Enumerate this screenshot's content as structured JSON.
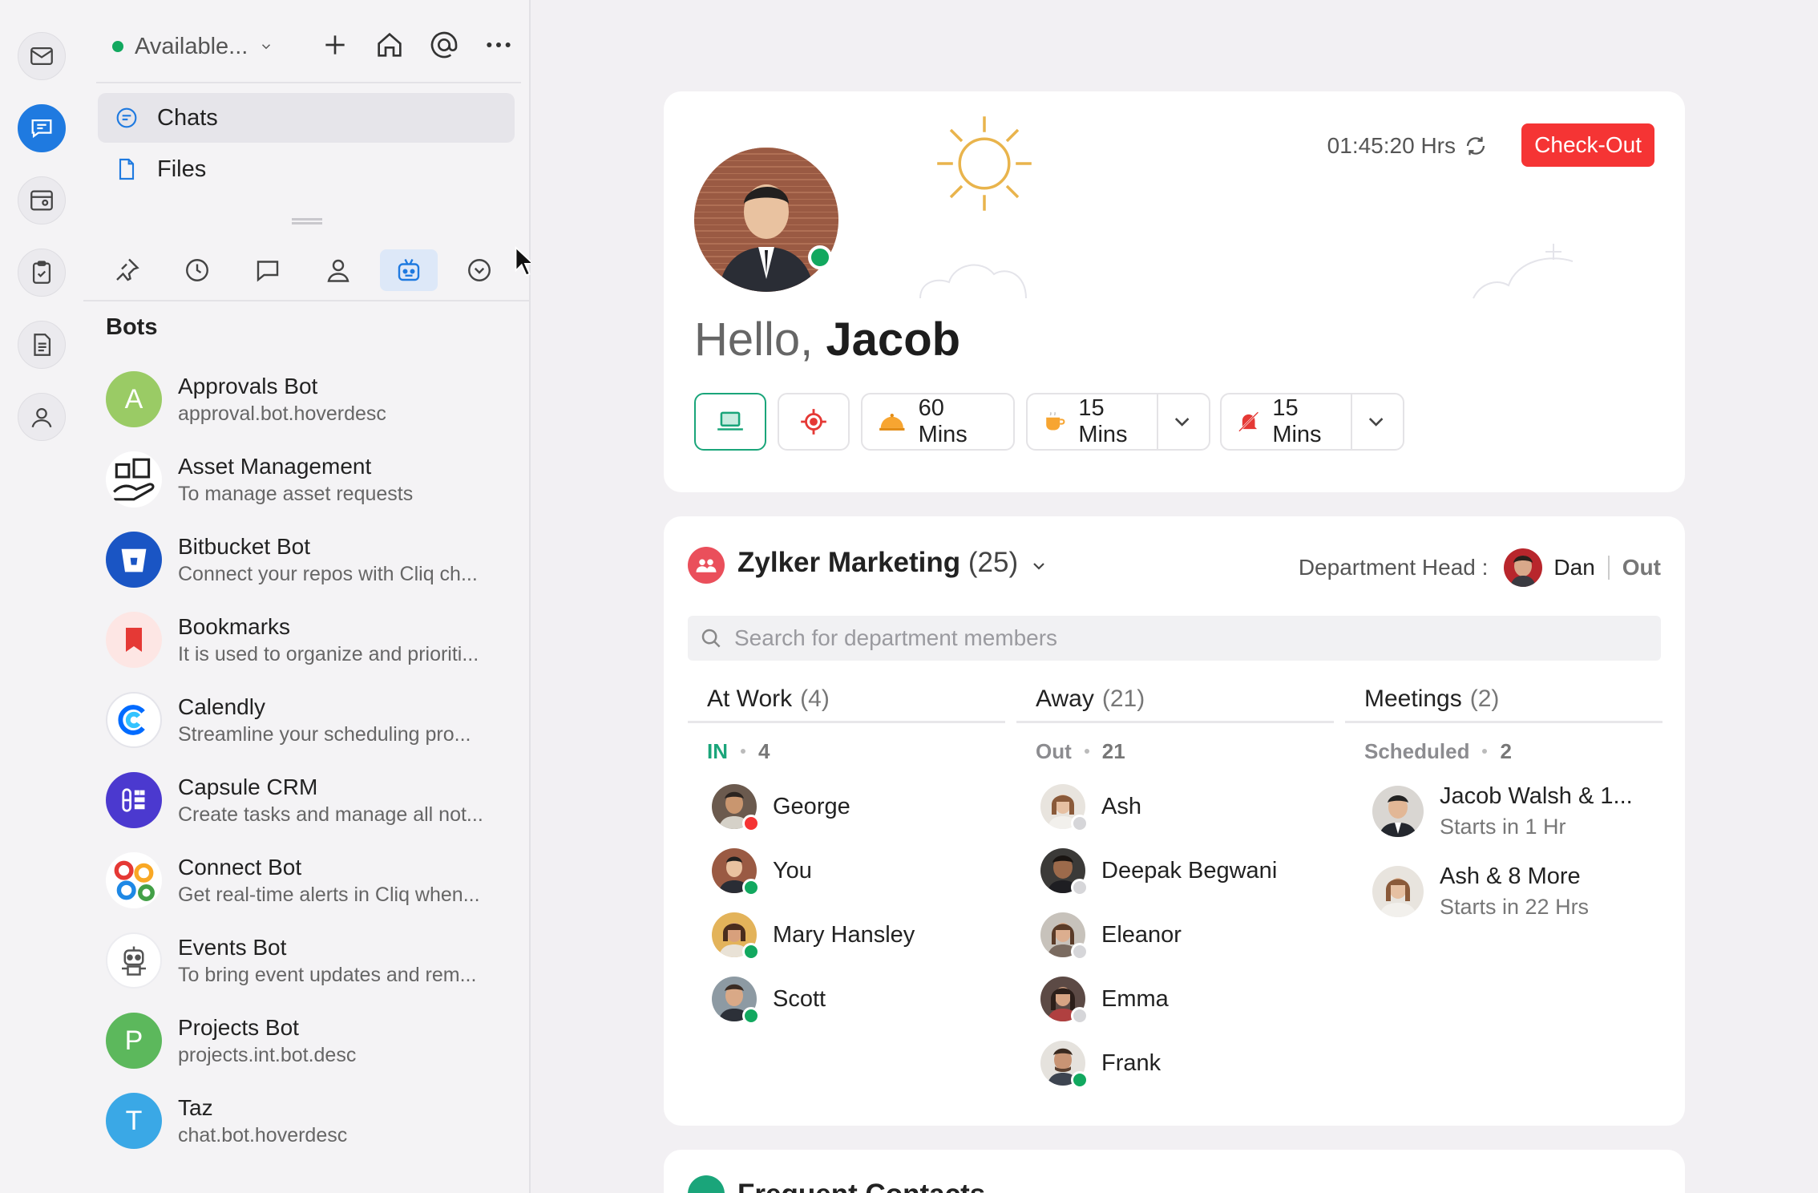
{
  "colors": {
    "accent": "#1f7ae0",
    "online": "#12a85f",
    "busy": "#f53434",
    "checkout": "#f53434",
    "at_work": "#1aa57a",
    "away": "#8c8c90",
    "dept_icon": "#ea4f5b"
  },
  "rail": {
    "items": [
      {
        "name": "mail-icon"
      },
      {
        "name": "chat-icon"
      },
      {
        "name": "inbox-icon"
      },
      {
        "name": "clipboard-icon"
      },
      {
        "name": "notes-icon"
      },
      {
        "name": "contacts-icon"
      }
    ]
  },
  "sidebar": {
    "status": "Available...",
    "nav": [
      {
        "label": "Chats",
        "icon": "chat-bubble-icon"
      },
      {
        "label": "Files",
        "icon": "file-icon"
      }
    ],
    "tabs": [
      "pin-icon",
      "clock-icon",
      "channels-icon",
      "contact-icon",
      "bot-icon",
      "more-icon"
    ],
    "section_title": "Bots",
    "bots": [
      {
        "name": "Approvals Bot",
        "desc": "approval.bot.hoverdesc",
        "initial": "A",
        "color": "#9acb65"
      },
      {
        "name": "Asset Management",
        "desc": "To manage asset requests",
        "initial": "",
        "color": "#ffffff"
      },
      {
        "name": "Bitbucket Bot",
        "desc": "Connect your repos with Cliq ch...",
        "initial": "",
        "color": "#1a55c4"
      },
      {
        "name": "Bookmarks",
        "desc": "It is used to organize and prioriti...",
        "initial": "",
        "color": "#fde6e4"
      },
      {
        "name": "Calendly",
        "desc": "Streamline your scheduling pro...",
        "initial": "",
        "color": "#ffffff"
      },
      {
        "name": "Capsule CRM",
        "desc": "Create tasks and manage all not...",
        "initial": "",
        "color": "#4b39cf"
      },
      {
        "name": "Connect Bot",
        "desc": "Get real-time alerts in Cliq when...",
        "initial": "",
        "color": "#ffffff"
      },
      {
        "name": "Events Bot",
        "desc": "To bring event updates and rem...",
        "initial": "",
        "color": "#ffffff"
      },
      {
        "name": "Projects Bot",
        "desc": "projects.int.bot.desc",
        "initial": "P",
        "color": "#5cb85c"
      },
      {
        "name": "Taz",
        "desc": "chat.bot.hoverdesc",
        "initial": "T",
        "color": "#3aa8e6"
      }
    ]
  },
  "hello": {
    "greeting": "Hello,",
    "name": "Jacob",
    "timer": "01:45:20 Hrs",
    "checkout": "Check-Out",
    "chips": [
      {
        "icon": "laptop-icon",
        "label": ""
      },
      {
        "icon": "target-icon",
        "label": ""
      },
      {
        "icon": "lunch-icon",
        "label": "60 Mins"
      },
      {
        "icon": "coffee-icon",
        "label": "15 Mins"
      },
      {
        "icon": "do-not-disturb-icon",
        "label": "15 Mins"
      }
    ]
  },
  "department": {
    "name": "Zylker Marketing",
    "count": "(25)",
    "head_label": "Department Head :",
    "head_name": "Dan",
    "head_status": "Out",
    "search_placeholder": "Search for department members",
    "columns": {
      "at_work": {
        "title": "At Work",
        "count": "(4)",
        "sub_label": "IN",
        "sub_count": "4",
        "members": [
          {
            "name": "George",
            "presence": "busy"
          },
          {
            "name": "You",
            "presence": "online"
          },
          {
            "name": "Mary  Hansley",
            "presence": "online"
          },
          {
            "name": "Scott",
            "presence": "online"
          }
        ]
      },
      "away": {
        "title": "Away",
        "count": "(21)",
        "sub_label": "Out",
        "sub_count": "21",
        "members": [
          {
            "name": "Ash",
            "presence": "offline"
          },
          {
            "name": "Deepak Begwani",
            "presence": "offline"
          },
          {
            "name": "Eleanor",
            "presence": "offline"
          },
          {
            "name": "Emma",
            "presence": "offline"
          },
          {
            "name": "Frank",
            "presence": "online"
          }
        ]
      },
      "meetings": {
        "title": "Meetings",
        "count": "(2)",
        "sub_label": "Scheduled",
        "sub_count": "2",
        "items": [
          {
            "title": "Jacob Walsh & 1...",
            "time": "Starts in 1 Hr"
          },
          {
            "title": "Ash & 8 More",
            "time": "Starts in 22 Hrs"
          }
        ]
      }
    }
  },
  "frequent": {
    "title": "Frequent Contacts"
  }
}
